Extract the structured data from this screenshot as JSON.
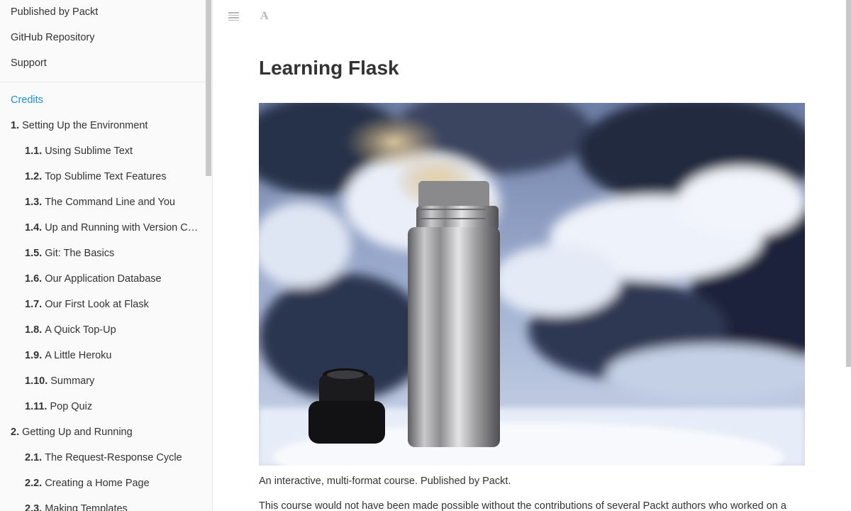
{
  "sidebar": {
    "top_links": [
      {
        "label": "Published by Packt"
      },
      {
        "label": "GitHub Repository"
      },
      {
        "label": "Support"
      }
    ],
    "toc": [
      {
        "num": "",
        "label": "Credits",
        "active": true
      },
      {
        "num": "1.",
        "label": "Setting Up the Environment"
      },
      {
        "num": "1.1.",
        "label": "Using Sublime Text"
      },
      {
        "num": "1.2.",
        "label": "Top Sublime Text Features"
      },
      {
        "num": "1.3.",
        "label": "The Command Line and You"
      },
      {
        "num": "1.4.",
        "label": "Up and Running with Version Co..."
      },
      {
        "num": "1.5.",
        "label": "Git: The Basics"
      },
      {
        "num": "1.6.",
        "label": "Our Application Database"
      },
      {
        "num": "1.7.",
        "label": "Our First Look at Flask"
      },
      {
        "num": "1.8.",
        "label": "A Quick Top-Up"
      },
      {
        "num": "1.9.",
        "label": "A Little Heroku"
      },
      {
        "num": "1.10.",
        "label": "Summary"
      },
      {
        "num": "1.11.",
        "label": "Pop Quiz"
      },
      {
        "num": "2.",
        "label": "Getting Up and Running"
      },
      {
        "num": "2.1.",
        "label": "The Request-Response Cycle"
      },
      {
        "num": "2.2.",
        "label": "Creating a Home Page"
      },
      {
        "num": "2.3.",
        "label": "Making Templates"
      }
    ]
  },
  "toolbar": {
    "menu_icon": "hamburger-menu-icon",
    "font_icon_label": "A"
  },
  "main": {
    "title": "Learning Flask",
    "description": "An interactive, multi-format course. Published by Packt.",
    "paragraph": "This course would not have been made possible without the contributions of several Packt authors who worked on a"
  },
  "colors": {
    "accent": "#1a8fd6",
    "sidebar_bg": "#fafafa",
    "text": "#333333"
  }
}
